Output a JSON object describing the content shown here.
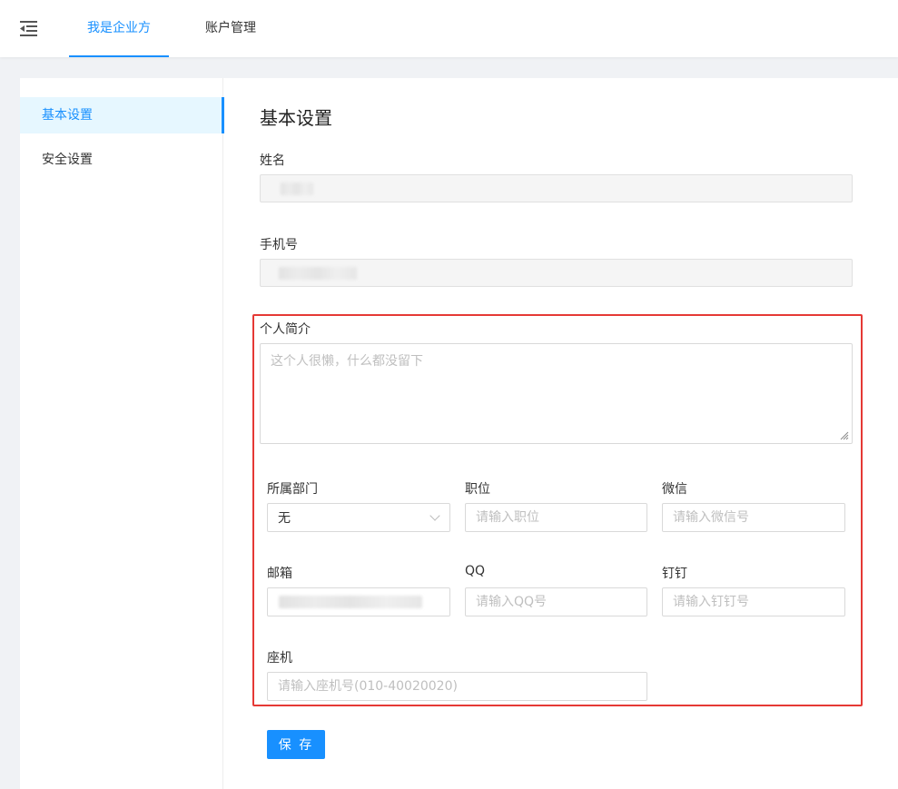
{
  "header": {
    "menu_icon": "menu-fold-icon",
    "tabs": [
      {
        "label": "我是企业方",
        "active": true
      },
      {
        "label": "账户管理",
        "active": false
      }
    ]
  },
  "sidebar": {
    "items": [
      {
        "label": "基本设置",
        "active": true
      },
      {
        "label": "安全设置",
        "active": false
      }
    ]
  },
  "form": {
    "title": "基本设置",
    "name": {
      "label": "姓名"
    },
    "phone": {
      "label": "手机号"
    },
    "bio": {
      "label": "个人简介",
      "placeholder": "这个人很懒，什么都没留下"
    },
    "department": {
      "label": "所属部门",
      "value": "无"
    },
    "position": {
      "label": "职位",
      "placeholder": "请输入职位"
    },
    "wechat": {
      "label": "微信",
      "placeholder": "请输入微信号"
    },
    "email": {
      "label": "邮箱"
    },
    "qq": {
      "label": "QQ",
      "placeholder": "请输入QQ号"
    },
    "dingtalk": {
      "label": "钉钉",
      "placeholder": "请输入钉钉号"
    },
    "landline": {
      "label": "座机",
      "placeholder": "请输入座机号(010-40020020)"
    },
    "save_label": "保 存"
  },
  "colors": {
    "accent": "#1890ff",
    "highlight_border": "#e53935"
  }
}
